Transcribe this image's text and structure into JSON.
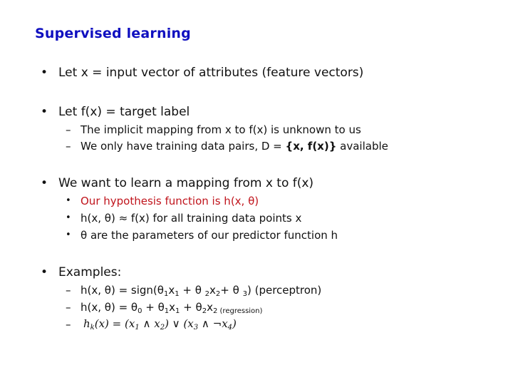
{
  "title": "Supervised learning",
  "sections": [
    {
      "text": "Let x = input vector of attributes (feature vectors)"
    },
    {
      "text": "Let f(x) = target label",
      "items": [
        "The implicit mapping from x to f(x) is unknown to us",
        {
          "pre": "We only have training data pairs, D = ",
          "bold": "{x, f(x)}",
          "post": " available"
        }
      ]
    },
    {
      "text": "We want to learn a mapping from x to f(x)",
      "items": [
        "Our hypothesis function is h(x, θ)",
        "h(x, θ) ≈ f(x) for all training data points x",
        "θ are the parameters of our predictor function h"
      ]
    },
    {
      "text": "Examples:",
      "items": [
        {
          "a": "h(x, θ) = sign(θ",
          "s1": "1",
          "b": "x",
          "s2": "1",
          "c": " + θ ",
          "s3": "2",
          "d": "x",
          "s4": "2",
          "e": "+ θ ",
          "s5": "3",
          "f": ") (perceptron)"
        },
        {
          "a": "h(x, θ) = θ",
          "s1": "0",
          "b": " + θ",
          "s2": "1",
          "c": "x",
          "s3": "1",
          "d": " + θ",
          "s4": "2",
          "e": "x",
          "s5": "2",
          "f": " (regression)"
        },
        {
          "formula": "h_k(x) = (x_1 ∧ x_2) ∨ (x_3 ∧ ¬x_4)"
        }
      ]
    }
  ],
  "symbols": {
    "bullet": "•",
    "dash": "–"
  }
}
